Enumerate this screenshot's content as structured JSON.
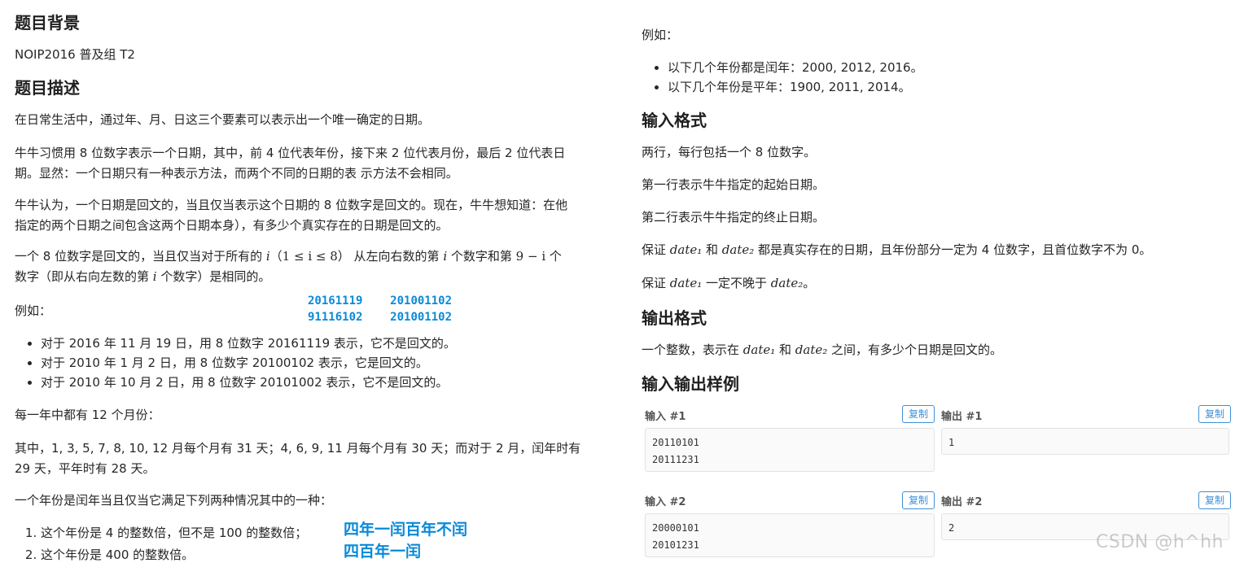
{
  "left": {
    "bg_heading": "题目背景",
    "bg_text": "NOIP2016 普及组 T2",
    "desc_heading": "题目描述",
    "p1": "在日常生活中，通过年、月、日这三个要素可以表示出一个唯一确定的日期。",
    "p2_line1": "牛牛习惯用 8 位数字表示一个日期，其中，前 4 位代表年份，接下来 2 位代表月份，最后 2 位代表日",
    "p2_line2": "期。显然：一个日期只有一种表示方法，而两个不同的日期的表 示方法不会相同。",
    "p3_line1": "牛牛认为，一个日期是回文的，当且仅当表示这个日期的 8 位数字是回文的。现在，牛牛想知道：在他",
    "p3_line2": "指定的两个日期之间包含这两个日期本身），有多少个真实存在的日期是回文的。",
    "p4_line1a": "一个 8 位数字是回文的，当且仅当对于所有的 ",
    "p4_math_i": "i",
    "p4_math_range": "（1 ≤ i ≤ 8）",
    "p4_line1b": " 从左向右数的第 ",
    "p4_math_i2": "i",
    "p4_line1c": " 个数字和第 ",
    "p4_math_9i": "9 − i",
    "p4_line1d": " 个",
    "p4_line2a": "数字（即从右向左数的第 ",
    "p4_math_i3": "i",
    "p4_line2b": " 个数字）是相同的。",
    "example_label": "例如：",
    "annot_row1_a": "20161119",
    "annot_row1_b": "201001102",
    "annot_row2_a": "91116102",
    "annot_row2_b": "201001102",
    "examples": [
      "对于 2016 年 11 月 19 日，用 8 位数字 20161119 表示，它不是回文的。",
      "对于 2010 年 1 月 2 日，用 8 位数字 20100102 表示，它是回文的。",
      "对于 2010 年 10 月 2 日，用 8 位数字 20101002 表示，它不是回文的。"
    ],
    "months_text": "每一年中都有 12 个月份：",
    "days_line1": "其中，1, 3, 5, 7, 8, 10, 12 月每个月有 31 天；4, 6, 9, 11 月每个月有 30 天；而对于 2 月，闰年时有",
    "days_line2": "29 天，平年时有 28 天。",
    "leap_text": "一个年份是闰年当且仅当它满足下列两种情况其中的一种：",
    "leap_rules": [
      "这个年份是 4 的整数倍，但不是 100 的整数倍；",
      "这个年份是 400 的整数倍。"
    ],
    "annot_leap1": "四年一闰百年不闰",
    "annot_leap2": "四百年一闰"
  },
  "right": {
    "example_label": "例如：",
    "leap_examples": [
      "以下几个年份都是闰年：2000, 2012, 2016。",
      "以下几个年份是平年：1900, 2011, 2014。"
    ],
    "input_heading": "输入格式",
    "in1": "两行，每行包括一个 8 位数字。",
    "in2": "第一行表示牛牛指定的起始日期。",
    "in3": "第二行表示牛牛指定的终止日期。",
    "in4a": "保证 ",
    "in4_date1": "date₁",
    "in4b": " 和 ",
    "in4_date2": "date₂",
    "in4c": " 都是真实存在的日期，且年份部分一定为 4 位数字，且首位数字不为 0。",
    "in5a": "保证 ",
    "in5_date1": "date₁",
    "in5b": " 一定不晚于 ",
    "in5_date2": "date₂",
    "in5c": "。",
    "output_heading": "输出格式",
    "out_a": "一个整数，表示在 ",
    "out_date1": "date₁",
    "out_b": " 和 ",
    "out_date2": "date₂",
    "out_c": " 之间，有多少个日期是回文的。",
    "samples_heading": "输入输出样例",
    "copy_label": "复制",
    "samples": [
      {
        "in_label": "输入 #1",
        "out_label": "输出 #1",
        "in_lines": [
          "20110101",
          "20111231"
        ],
        "out_lines": [
          "1"
        ]
      },
      {
        "in_label": "输入 #2",
        "out_label": "输出 #2",
        "in_lines": [
          "20000101",
          "20101231"
        ],
        "out_lines": [
          "2"
        ]
      }
    ]
  },
  "watermark": "CSDN @h^hh",
  "colors": {
    "annotation": "#0a8ad8",
    "copy_button": "#3e8fd6",
    "text": "#262626"
  }
}
